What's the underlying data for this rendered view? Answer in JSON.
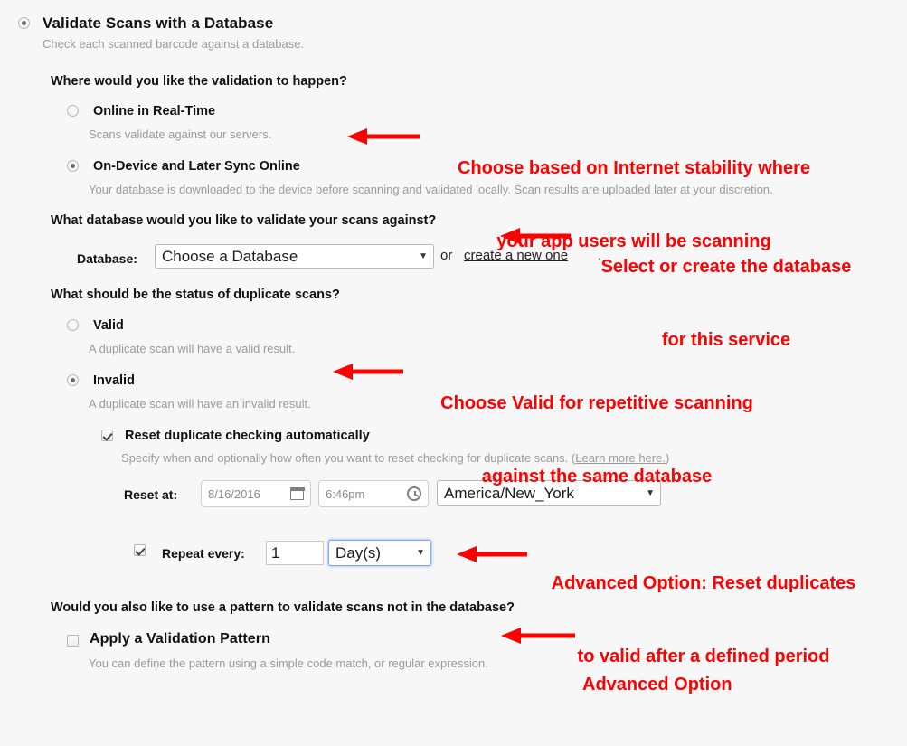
{
  "option": {
    "title": "Validate Scans with a Database",
    "subtitle": "Check each scanned barcode against a database.",
    "selected": true
  },
  "sections": {
    "where": {
      "question": "Where would you like the validation to happen?",
      "choices": [
        {
          "label": "Online in Real-Time",
          "sub": "Scans validate against our servers.",
          "selected": false
        },
        {
          "label": "On-Device and Later Sync Online",
          "sub": "Your database is downloaded to the device before scanning and validated locally. Scan results are uploaded later at your discretion.",
          "selected": true
        }
      ]
    },
    "database": {
      "question": "What database would you like to validate your scans against?",
      "field_label": "Database:",
      "select_value": "Choose a Database",
      "or_text": "or",
      "link_text": "create a new one",
      "period": "."
    },
    "duplicates": {
      "question": "What should be the status of duplicate scans?",
      "choices": [
        {
          "label": "Valid",
          "sub": "A duplicate scan will have a valid result.",
          "selected": false
        },
        {
          "label": "Invalid",
          "sub": "A duplicate scan will have an invalid result.",
          "selected": true
        }
      ],
      "reset_auto": {
        "label": "Reset duplicate checking automatically",
        "sub_before": "Specify when and optionally how often you want to reset checking for duplicate scans. (",
        "sub_link": "Learn more here.",
        "sub_after": ")",
        "checked": true
      },
      "reset_at": {
        "label": "Reset at:",
        "date_value": "8/16/2016",
        "time_value": "6:46pm",
        "timezone_value": "America/New_York",
        "date_icon": "calendar-icon",
        "time_icon": "clock-icon"
      },
      "repeat": {
        "label": "Repeat every:",
        "checked": true,
        "interval_value": "1",
        "unit_value": "Day(s)"
      }
    },
    "pattern": {
      "question": "Would you also like to use a pattern to validate scans not in the database?",
      "checkbox_label": "Apply a Validation Pattern",
      "sub": "You can define the pattern using a simple code match, or regular expression.",
      "checked": false
    }
  },
  "annotations": {
    "color": "#ff0000",
    "items": [
      {
        "line1": "Choose based on Internet stability where",
        "line2": "your app users will be scanning"
      },
      {
        "line1": "Select or create the database",
        "line2": "for this service"
      },
      {
        "line1": "Choose Valid for repetitive scanning",
        "line2": "against the same database"
      },
      {
        "line1": "Advanced Option: Reset duplicates",
        "line2": "to valid after a defined period"
      },
      {
        "line1": "Advanced Option",
        "line2": ""
      }
    ]
  }
}
